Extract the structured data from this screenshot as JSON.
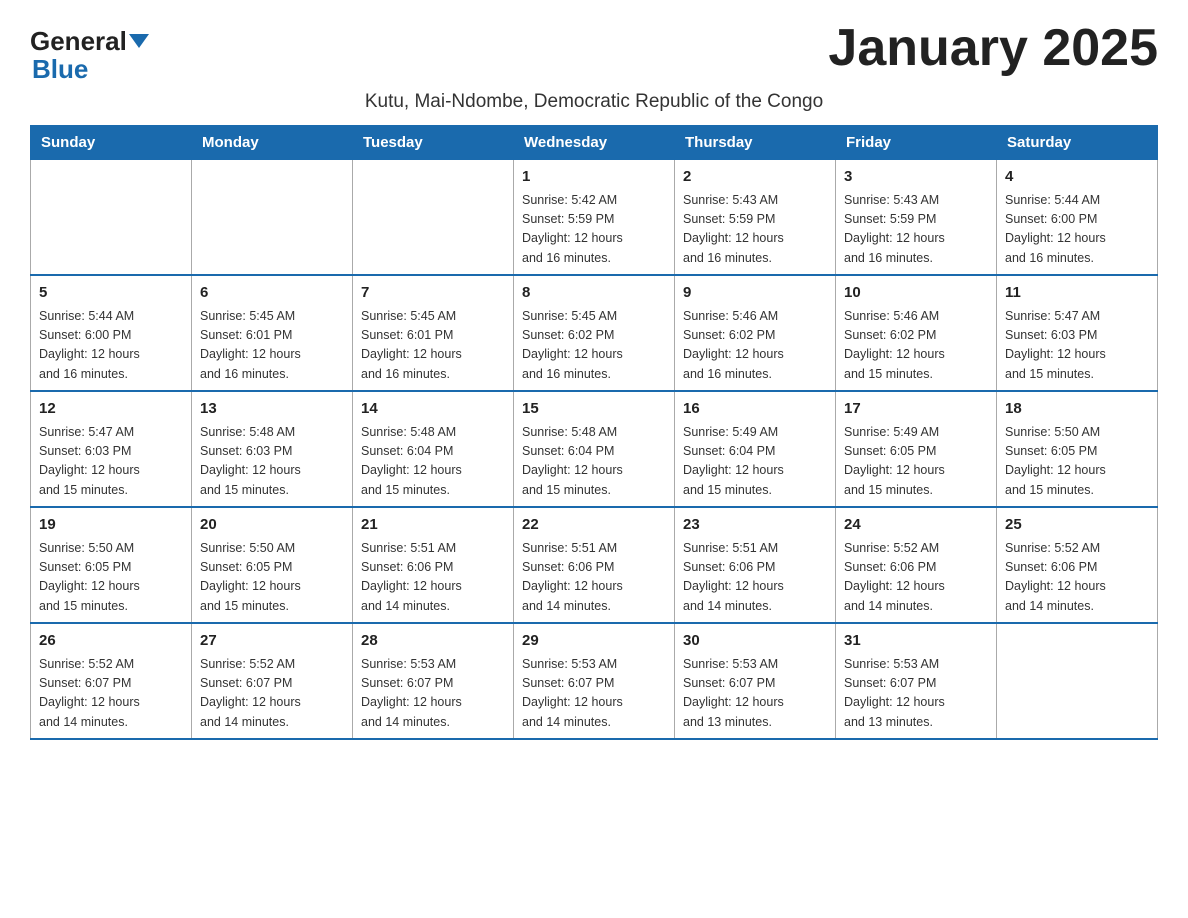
{
  "logo": {
    "general": "General",
    "blue": "Blue"
  },
  "title": "January 2025",
  "subtitle": "Kutu, Mai-Ndombe, Democratic Republic of the Congo",
  "days_of_week": [
    "Sunday",
    "Monday",
    "Tuesday",
    "Wednesday",
    "Thursday",
    "Friday",
    "Saturday"
  ],
  "weeks": [
    [
      {
        "day": "",
        "info": ""
      },
      {
        "day": "",
        "info": ""
      },
      {
        "day": "",
        "info": ""
      },
      {
        "day": "1",
        "info": "Sunrise: 5:42 AM\nSunset: 5:59 PM\nDaylight: 12 hours\nand 16 minutes."
      },
      {
        "day": "2",
        "info": "Sunrise: 5:43 AM\nSunset: 5:59 PM\nDaylight: 12 hours\nand 16 minutes."
      },
      {
        "day": "3",
        "info": "Sunrise: 5:43 AM\nSunset: 5:59 PM\nDaylight: 12 hours\nand 16 minutes."
      },
      {
        "day": "4",
        "info": "Sunrise: 5:44 AM\nSunset: 6:00 PM\nDaylight: 12 hours\nand 16 minutes."
      }
    ],
    [
      {
        "day": "5",
        "info": "Sunrise: 5:44 AM\nSunset: 6:00 PM\nDaylight: 12 hours\nand 16 minutes."
      },
      {
        "day": "6",
        "info": "Sunrise: 5:45 AM\nSunset: 6:01 PM\nDaylight: 12 hours\nand 16 minutes."
      },
      {
        "day": "7",
        "info": "Sunrise: 5:45 AM\nSunset: 6:01 PM\nDaylight: 12 hours\nand 16 minutes."
      },
      {
        "day": "8",
        "info": "Sunrise: 5:45 AM\nSunset: 6:02 PM\nDaylight: 12 hours\nand 16 minutes."
      },
      {
        "day": "9",
        "info": "Sunrise: 5:46 AM\nSunset: 6:02 PM\nDaylight: 12 hours\nand 16 minutes."
      },
      {
        "day": "10",
        "info": "Sunrise: 5:46 AM\nSunset: 6:02 PM\nDaylight: 12 hours\nand 15 minutes."
      },
      {
        "day": "11",
        "info": "Sunrise: 5:47 AM\nSunset: 6:03 PM\nDaylight: 12 hours\nand 15 minutes."
      }
    ],
    [
      {
        "day": "12",
        "info": "Sunrise: 5:47 AM\nSunset: 6:03 PM\nDaylight: 12 hours\nand 15 minutes."
      },
      {
        "day": "13",
        "info": "Sunrise: 5:48 AM\nSunset: 6:03 PM\nDaylight: 12 hours\nand 15 minutes."
      },
      {
        "day": "14",
        "info": "Sunrise: 5:48 AM\nSunset: 6:04 PM\nDaylight: 12 hours\nand 15 minutes."
      },
      {
        "day": "15",
        "info": "Sunrise: 5:48 AM\nSunset: 6:04 PM\nDaylight: 12 hours\nand 15 minutes."
      },
      {
        "day": "16",
        "info": "Sunrise: 5:49 AM\nSunset: 6:04 PM\nDaylight: 12 hours\nand 15 minutes."
      },
      {
        "day": "17",
        "info": "Sunrise: 5:49 AM\nSunset: 6:05 PM\nDaylight: 12 hours\nand 15 minutes."
      },
      {
        "day": "18",
        "info": "Sunrise: 5:50 AM\nSunset: 6:05 PM\nDaylight: 12 hours\nand 15 minutes."
      }
    ],
    [
      {
        "day": "19",
        "info": "Sunrise: 5:50 AM\nSunset: 6:05 PM\nDaylight: 12 hours\nand 15 minutes."
      },
      {
        "day": "20",
        "info": "Sunrise: 5:50 AM\nSunset: 6:05 PM\nDaylight: 12 hours\nand 15 minutes."
      },
      {
        "day": "21",
        "info": "Sunrise: 5:51 AM\nSunset: 6:06 PM\nDaylight: 12 hours\nand 14 minutes."
      },
      {
        "day": "22",
        "info": "Sunrise: 5:51 AM\nSunset: 6:06 PM\nDaylight: 12 hours\nand 14 minutes."
      },
      {
        "day": "23",
        "info": "Sunrise: 5:51 AM\nSunset: 6:06 PM\nDaylight: 12 hours\nand 14 minutes."
      },
      {
        "day": "24",
        "info": "Sunrise: 5:52 AM\nSunset: 6:06 PM\nDaylight: 12 hours\nand 14 minutes."
      },
      {
        "day": "25",
        "info": "Sunrise: 5:52 AM\nSunset: 6:06 PM\nDaylight: 12 hours\nand 14 minutes."
      }
    ],
    [
      {
        "day": "26",
        "info": "Sunrise: 5:52 AM\nSunset: 6:07 PM\nDaylight: 12 hours\nand 14 minutes."
      },
      {
        "day": "27",
        "info": "Sunrise: 5:52 AM\nSunset: 6:07 PM\nDaylight: 12 hours\nand 14 minutes."
      },
      {
        "day": "28",
        "info": "Sunrise: 5:53 AM\nSunset: 6:07 PM\nDaylight: 12 hours\nand 14 minutes."
      },
      {
        "day": "29",
        "info": "Sunrise: 5:53 AM\nSunset: 6:07 PM\nDaylight: 12 hours\nand 14 minutes."
      },
      {
        "day": "30",
        "info": "Sunrise: 5:53 AM\nSunset: 6:07 PM\nDaylight: 12 hours\nand 13 minutes."
      },
      {
        "day": "31",
        "info": "Sunrise: 5:53 AM\nSunset: 6:07 PM\nDaylight: 12 hours\nand 13 minutes."
      },
      {
        "day": "",
        "info": ""
      }
    ]
  ]
}
